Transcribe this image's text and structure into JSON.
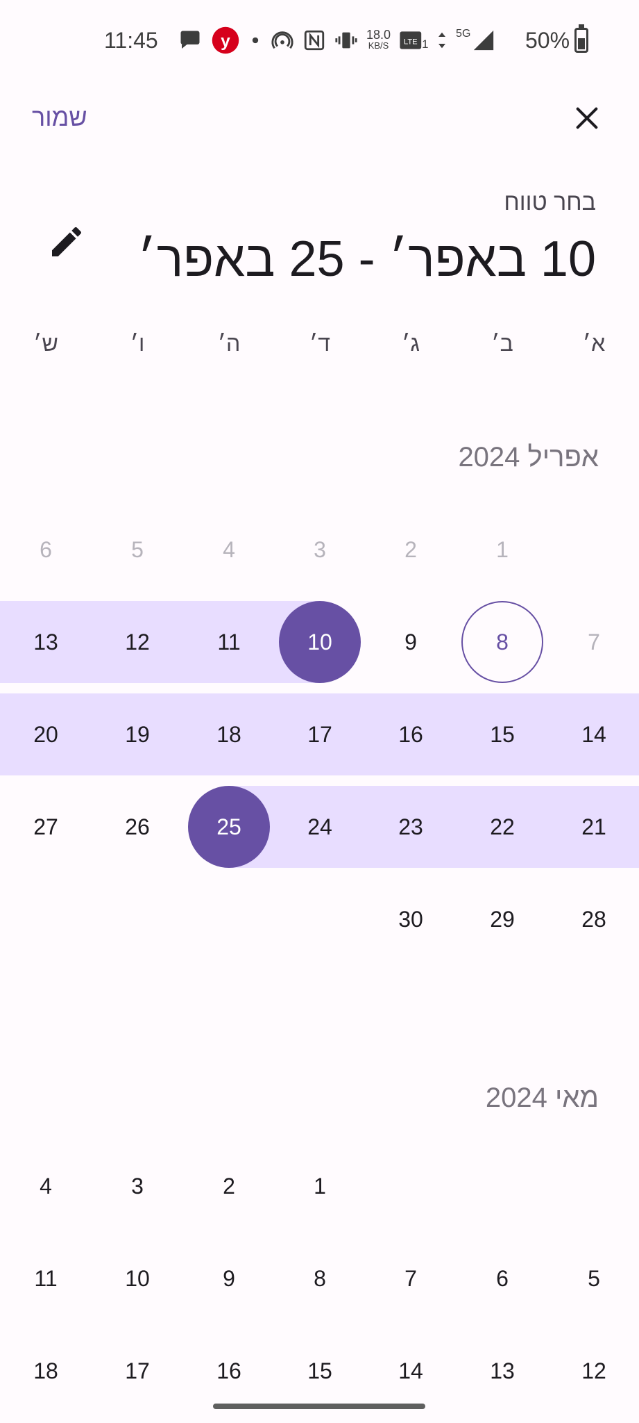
{
  "status_bar": {
    "time": "11:45",
    "speed": "18.0",
    "speed_unit": "KB/S",
    "battery": "50%",
    "network": "5G",
    "volte": "Vo LTE",
    "icons": [
      "chat-bubble-icon",
      "ynet-app-icon",
      "dot-icon",
      "hotspot-icon",
      "nfc-icon",
      "vibrate-icon",
      "volte-icon",
      "data-arrows-icon",
      "signal-icon",
      "battery-icon"
    ]
  },
  "header": {
    "save_label": "שמור",
    "close_icon": "close-icon",
    "title": "בחר טווח",
    "range_text": "10 באפר׳ - 25 באפר׳",
    "edit_icon": "pencil-icon"
  },
  "weekdays": [
    "א׳",
    "ב׳",
    "ג׳",
    "ד׳",
    "ה׳",
    "ו׳",
    "ש׳"
  ],
  "months": [
    {
      "title": "אפריל 2024",
      "weeks": [
        [
          {
            "d": ""
          },
          {
            "d": "1",
            "muted": true
          },
          {
            "d": "2",
            "muted": true
          },
          {
            "d": "3",
            "muted": true
          },
          {
            "d": "4",
            "muted": true
          },
          {
            "d": "5",
            "muted": true
          },
          {
            "d": "6",
            "muted": true
          }
        ],
        [
          {
            "d": "7",
            "muted": true
          },
          {
            "d": "8",
            "today": true
          },
          {
            "d": "9"
          },
          {
            "d": "10",
            "start": true
          },
          {
            "d": "11",
            "inrange": true
          },
          {
            "d": "12",
            "inrange": true
          },
          {
            "d": "13",
            "inrange": true
          }
        ],
        [
          {
            "d": "14",
            "inrange": true
          },
          {
            "d": "15",
            "inrange": true
          },
          {
            "d": "16",
            "inrange": true
          },
          {
            "d": "17",
            "inrange": true
          },
          {
            "d": "18",
            "inrange": true
          },
          {
            "d": "19",
            "inrange": true
          },
          {
            "d": "20",
            "inrange": true
          }
        ],
        [
          {
            "d": "21",
            "inrange": true
          },
          {
            "d": "22",
            "inrange": true
          },
          {
            "d": "23",
            "inrange": true
          },
          {
            "d": "24",
            "inrange": true
          },
          {
            "d": "25",
            "end": true
          },
          {
            "d": "26"
          },
          {
            "d": "27"
          }
        ],
        [
          {
            "d": "28"
          },
          {
            "d": "29"
          },
          {
            "d": "30"
          },
          {
            "d": ""
          },
          {
            "d": ""
          },
          {
            "d": ""
          },
          {
            "d": ""
          }
        ]
      ]
    },
    {
      "title": "מאי 2024",
      "weeks": [
        [
          {
            "d": ""
          },
          {
            "d": ""
          },
          {
            "d": ""
          },
          {
            "d": "1"
          },
          {
            "d": "2"
          },
          {
            "d": "3"
          },
          {
            "d": "4"
          }
        ],
        [
          {
            "d": "5"
          },
          {
            "d": "6"
          },
          {
            "d": "7"
          },
          {
            "d": "8"
          },
          {
            "d": "9"
          },
          {
            "d": "10"
          },
          {
            "d": "11"
          }
        ],
        [
          {
            "d": "12"
          },
          {
            "d": "13"
          },
          {
            "d": "14"
          },
          {
            "d": "15"
          },
          {
            "d": "16"
          },
          {
            "d": "17"
          },
          {
            "d": "18"
          }
        ]
      ]
    }
  ],
  "colors": {
    "accent": "#6750a4",
    "range_band": "#e8ddff",
    "background": "#fffbfe"
  }
}
